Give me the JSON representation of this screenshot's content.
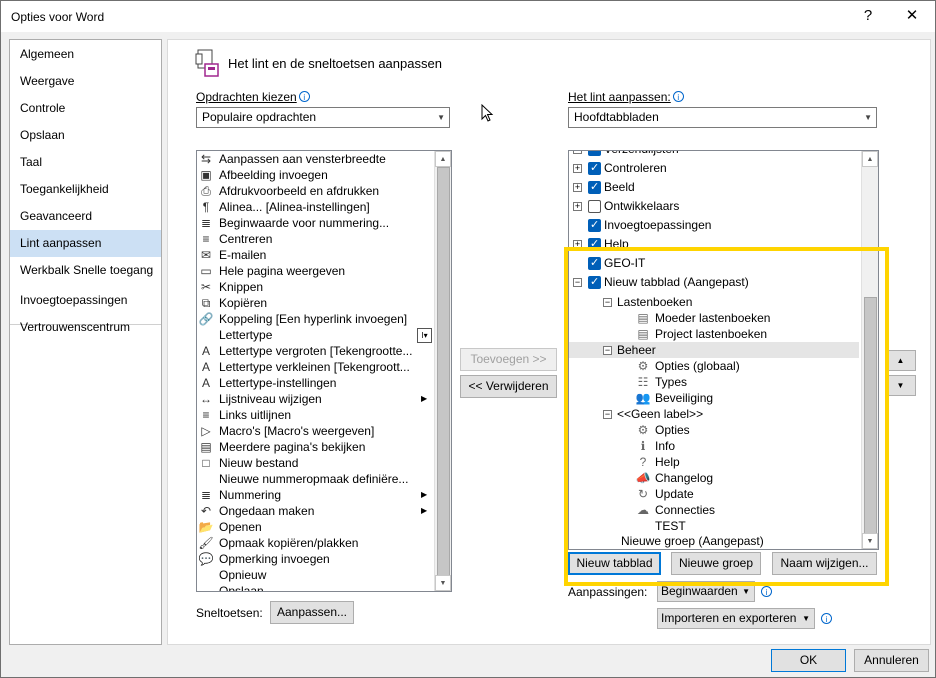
{
  "window": {
    "title": "Opties voor Word",
    "help": "?",
    "close": "✕"
  },
  "nav": {
    "items": [
      {
        "label": "Algemeen"
      },
      {
        "label": "Weergave"
      },
      {
        "label": "Controle"
      },
      {
        "label": "Opslaan"
      },
      {
        "label": "Taal"
      },
      {
        "label": "Toegankelijkheid"
      },
      {
        "label": "Geavanceerd"
      },
      {
        "label": "Lint aanpassen",
        "selected": true
      },
      {
        "label": "Werkbalk Snelle toegang"
      },
      {
        "label": "Invoegtoepassingen"
      },
      {
        "label": "Vertrouwenscentrum"
      }
    ]
  },
  "header": {
    "title": "Het lint en de sneltoetsen aanpassen"
  },
  "left": {
    "label": "Opdrachten kiezen",
    "combo_value": "Populaire opdrachten",
    "commands": [
      {
        "icon": "⇆",
        "text": "Aanpassen aan vensterbreedte"
      },
      {
        "icon": "▣",
        "text": "Afbeelding invoegen"
      },
      {
        "icon": "⎙",
        "text": "Afdrukvoorbeeld en afdrukken"
      },
      {
        "icon": "¶",
        "text": "Alinea... [Alinea-instellingen]"
      },
      {
        "icon": "≣",
        "text": "Beginwaarde voor nummering..."
      },
      {
        "icon": "≡",
        "text": "Centreren"
      },
      {
        "icon": "✉",
        "text": "E-mailen"
      },
      {
        "icon": "▭",
        "text": "Hele pagina weergeven"
      },
      {
        "icon": "✂",
        "text": "Knippen"
      },
      {
        "icon": "⧉",
        "text": "Kopiëren"
      },
      {
        "icon": "🔗",
        "text": "Koppeling [Een hyperlink invoegen]"
      },
      {
        "icon": "",
        "text": "Lettertype"
      },
      {
        "icon": "A",
        "text": "Lettertype vergroten [Tekengrootte..."
      },
      {
        "icon": "A",
        "text": "Lettertype verkleinen [Tekengroott..."
      },
      {
        "icon": "A",
        "text": "Lettertype-instellingen"
      },
      {
        "icon": "↔",
        "text": "Lijstniveau wijzigen",
        "sub": true
      },
      {
        "icon": "≡",
        "text": "Links uitlijnen"
      },
      {
        "icon": "▷",
        "text": "Macro's [Macro's weergeven]"
      },
      {
        "icon": "▤",
        "text": "Meerdere pagina's bekijken"
      },
      {
        "icon": "□",
        "text": "Nieuw bestand"
      },
      {
        "icon": "",
        "text": "Nieuwe nummeropmaak definiëre..."
      },
      {
        "icon": "≣",
        "text": "Nummering",
        "sub": true
      },
      {
        "icon": "↶",
        "text": "Ongedaan maken",
        "sub": true
      },
      {
        "icon": "📂",
        "text": "Openen"
      },
      {
        "icon": "🖌",
        "text": "Opmaak kopiëren/plakken"
      },
      {
        "icon": "💬",
        "text": "Opmerking invoegen"
      },
      {
        "icon": "",
        "text": "Opnieuw"
      },
      {
        "icon": "▬",
        "text": "Opslaan"
      }
    ]
  },
  "middle": {
    "add": "Toevoegen >>",
    "remove": "<< Verwijderen"
  },
  "right": {
    "label": "Het lint aanpassen:",
    "combo_value": "Hoofdtabbladen",
    "tree": [
      {
        "level": 0,
        "expander": "+",
        "check": "on",
        "text": "Verzendlijsten"
      },
      {
        "level": 0,
        "expander": "+",
        "check": "on",
        "text": "Controleren"
      },
      {
        "level": 0,
        "expander": "+",
        "check": "on",
        "text": "Beeld"
      },
      {
        "level": 0,
        "expander": "+",
        "check": "off",
        "text": "Ontwikkelaars"
      },
      {
        "level": 0,
        "expander": "",
        "check": "on",
        "text": "Invoegtoepassingen"
      },
      {
        "level": 0,
        "expander": "+",
        "check": "on",
        "text": "Help"
      },
      {
        "level": 0,
        "expander": "",
        "check": "on",
        "text": "GEO-IT"
      },
      {
        "level": 0,
        "expander": "−",
        "check": "on",
        "text": "Nieuw tabblad (Aangepast)"
      },
      {
        "level": 1,
        "expander": "−",
        "text": "Lastenboeken"
      },
      {
        "level": 2,
        "icon": "▤",
        "text": "Moeder lastenboeken"
      },
      {
        "level": 2,
        "icon": "▤",
        "text": "Project lastenboeken"
      },
      {
        "level": 1,
        "expander": "−",
        "text": "Beheer",
        "selected": true
      },
      {
        "level": 2,
        "icon": "⚙",
        "text": "Opties (globaal)"
      },
      {
        "level": 2,
        "icon": "☷",
        "text": "Types"
      },
      {
        "level": 2,
        "icon": "👥",
        "text": "Beveiliging"
      },
      {
        "level": 1,
        "expander": "−",
        "text": "<<Geen label>>"
      },
      {
        "level": 2,
        "icon": "⚙",
        "text": "Opties"
      },
      {
        "level": 2,
        "icon": "ℹ",
        "text": "Info"
      },
      {
        "level": 2,
        "icon": "?",
        "text": "Help"
      },
      {
        "level": 2,
        "icon": "📣",
        "text": "Changelog"
      },
      {
        "level": 2,
        "icon": "↻",
        "text": "Update"
      },
      {
        "level": 2,
        "icon": "☁",
        "text": "Connecties"
      },
      {
        "level": 2,
        "icon": "",
        "text": "TEST"
      },
      {
        "level": 1,
        "expander": "",
        "text": "Nieuwe groep (Aangepast)"
      }
    ],
    "new_tab": "Nieuw tabblad",
    "new_group": "Nieuwe groep",
    "rename": "Naam wijzigen...",
    "customizations_label": "Aanpassingen:",
    "reset": "Beginwaarden",
    "import_export": "Importeren en exporteren"
  },
  "shortcuts": {
    "label": "Sneltoetsen:",
    "button": "Aanpassen..."
  },
  "footer": {
    "ok": "OK",
    "cancel": "Annuleren"
  },
  "colors": {
    "highlight": "#ffd400",
    "accent": "#005fb8",
    "nav_selected": "#cce0f4"
  }
}
